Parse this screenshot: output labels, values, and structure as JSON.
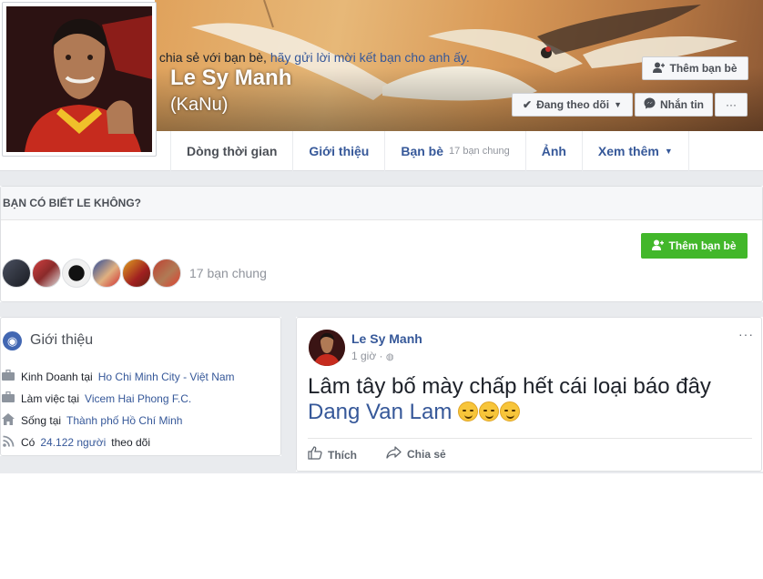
{
  "profile": {
    "name": "Le Sy Manh",
    "alt_name": "(KaNu)"
  },
  "buttons": {
    "add_friend": "Thêm bạn bè",
    "following": "Đang theo dõi",
    "message": "Nhắn tin",
    "more": "···"
  },
  "nav": {
    "tabs": [
      {
        "label": "Dòng thời gian"
      },
      {
        "label": "Giới thiệu"
      },
      {
        "label": "Bạn bè",
        "sub": "17 bạn chung"
      },
      {
        "label": "Ảnh"
      },
      {
        "label": "Xem thêm"
      }
    ]
  },
  "know": {
    "heading": "BẠN CÓ BIẾT LE KHÔNG?",
    "text": "Để xem những điều anh ấy chia sẻ với bạn bè,",
    "link": "hãy gửi lời mời kết bạn cho anh ấy.",
    "button": "Thêm bạn bè",
    "mutual": "17 bạn chung"
  },
  "intro": {
    "title": "Giới thiệu",
    "rows": [
      {
        "prefix": "Kinh Doanh tại",
        "link": "Ho Chi Minh City - Việt Nam",
        "suffix": ""
      },
      {
        "prefix": "Làm việc tại",
        "link": "Vicem Hai Phong F.C.",
        "suffix": ""
      },
      {
        "prefix": "Sống tại",
        "link": "Thành phố Hồ Chí Minh",
        "suffix": ""
      },
      {
        "prefix": "Có",
        "link": "24.122 người",
        "suffix": "theo dõi"
      }
    ]
  },
  "post": {
    "author": "Le Sy Manh",
    "time": "1 giờ ·",
    "text": "Lâm tây bố mày chấp hết cái loại báo đây",
    "mention": "Dang Van Lam",
    "like": "Thích",
    "share": "Chia sẻ",
    "more": "···"
  },
  "colors": {
    "link": "#365899",
    "green": "#42b72a",
    "text": "#1d2129",
    "muted": "#90949c"
  }
}
